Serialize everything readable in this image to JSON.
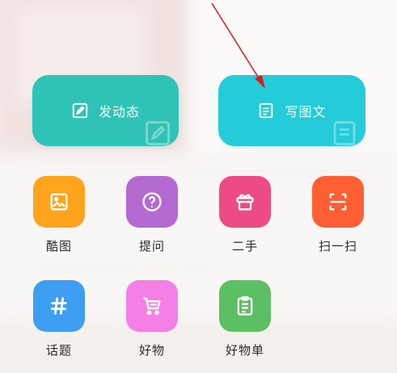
{
  "actions": {
    "post": {
      "label": "发动态",
      "icon": "edit-icon",
      "color": "#2ec3b6"
    },
    "article": {
      "label": "写图文",
      "icon": "document-icon",
      "color": "#24cbd8"
    }
  },
  "grid": {
    "cool_image": {
      "label": "酷图",
      "icon": "image-icon",
      "color": "#ffa41c"
    },
    "question": {
      "label": "提问",
      "icon": "question-icon",
      "color": "#b46ad1"
    },
    "second_hand": {
      "label": "二手",
      "icon": "gift-box-icon",
      "color": "#ec4b85"
    },
    "scan": {
      "label": "扫一扫",
      "icon": "scan-icon",
      "color": "#ff5f32"
    },
    "topic": {
      "label": "话题",
      "icon": "hashtag-icon",
      "color": "#3e9ff2"
    },
    "goods": {
      "label": "好物",
      "icon": "cart-icon",
      "color": "#f47fe5"
    },
    "goods_list": {
      "label": "好物单",
      "icon": "clipboard-icon",
      "color": "#5cbf63"
    }
  },
  "annotation": {
    "arrow_color": "#d62020"
  }
}
